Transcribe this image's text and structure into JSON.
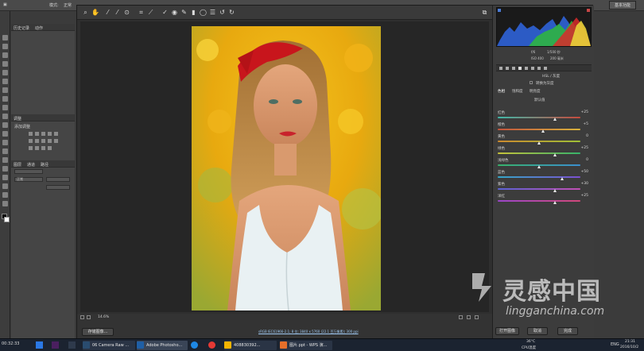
{
  "ps_topbar": {
    "menu": [
      "模式:",
      "正常",
      "不透明度:",
      "流量:"
    ],
    "workspace_button": "基本功能"
  },
  "ps_panels": {
    "history_tabs": [
      "历史记录",
      "动作"
    ],
    "adjust_tabs": [
      "调整"
    ],
    "adjust_title": "添加调整",
    "layers_tabs": [
      "图层",
      "通道",
      "路径"
    ],
    "layer_kind": "正常"
  },
  "acr": {
    "readouts": {
      "aperture": "f/6",
      "shutter": "1/500 秒",
      "iso": "ISO 400",
      "focal": "200 毫米"
    },
    "panel_title": "HSL / 灰度",
    "convert_grayscale": "转换为灰度",
    "tabs": [
      "色相",
      "饱和度",
      "明亮度"
    ],
    "defaults": "默认值",
    "sliders": [
      {
        "label": "红色",
        "value": "+25",
        "pos": 0.7,
        "track": "linear-gradient(90deg,#3fb7a8,#c74a3c)"
      },
      {
        "label": "橙色",
        "value": "+5",
        "pos": 0.55,
        "track": "linear-gradient(90deg,#c2543d,#d8b23c)"
      },
      {
        "label": "黄色",
        "value": "0",
        "pos": 0.5,
        "track": "linear-gradient(90deg,#cc8a2e,#9fbf36)"
      },
      {
        "label": "绿色",
        "value": "+25",
        "pos": 0.7,
        "track": "linear-gradient(90deg,#c6c23a,#36b36a)"
      },
      {
        "label": "浅绿色",
        "value": "0",
        "pos": 0.5,
        "track": "linear-gradient(90deg,#37b26b,#3a8fd0)"
      },
      {
        "label": "蓝色",
        "value": "+50",
        "pos": 0.78,
        "track": "linear-gradient(90deg,#34a7c8,#7c4fd1)"
      },
      {
        "label": "紫色",
        "value": "+30",
        "pos": 0.7,
        "track": "linear-gradient(90deg,#5b62d6,#c24fb5)"
      },
      {
        "label": "洋红",
        "value": "+25",
        "pos": 0.7,
        "track": "linear-gradient(90deg,#9b47c9,#d1487a)"
      }
    ],
    "zoom": "14.6%",
    "file_info": "sRGB IEC61966-2.1; 8 位; 3840 x 5760 (22.1 百万像素); 300 ppi",
    "save_button": "存储图像...",
    "open_button": "打开图像",
    "cancel_button": "取消",
    "done_button": "完成"
  },
  "taskbar": {
    "time_left": "00:32:33",
    "tasks": [
      "06 Camera Raw ...",
      "Adobe Photosho...",
      "408830392...",
      "图片.ppt - WPS 演..."
    ],
    "temp": "36°C",
    "cpu": "CPU温度",
    "lang": "ENG",
    "clock_time": "21:31",
    "clock_date": "2016/10/2"
  },
  "watermark": {
    "name_cn": "灵感中国",
    "url": "lingganchina.com"
  },
  "colors": {
    "accent": "#2b7fd6",
    "dialog_bg": "#2f2f2f"
  }
}
